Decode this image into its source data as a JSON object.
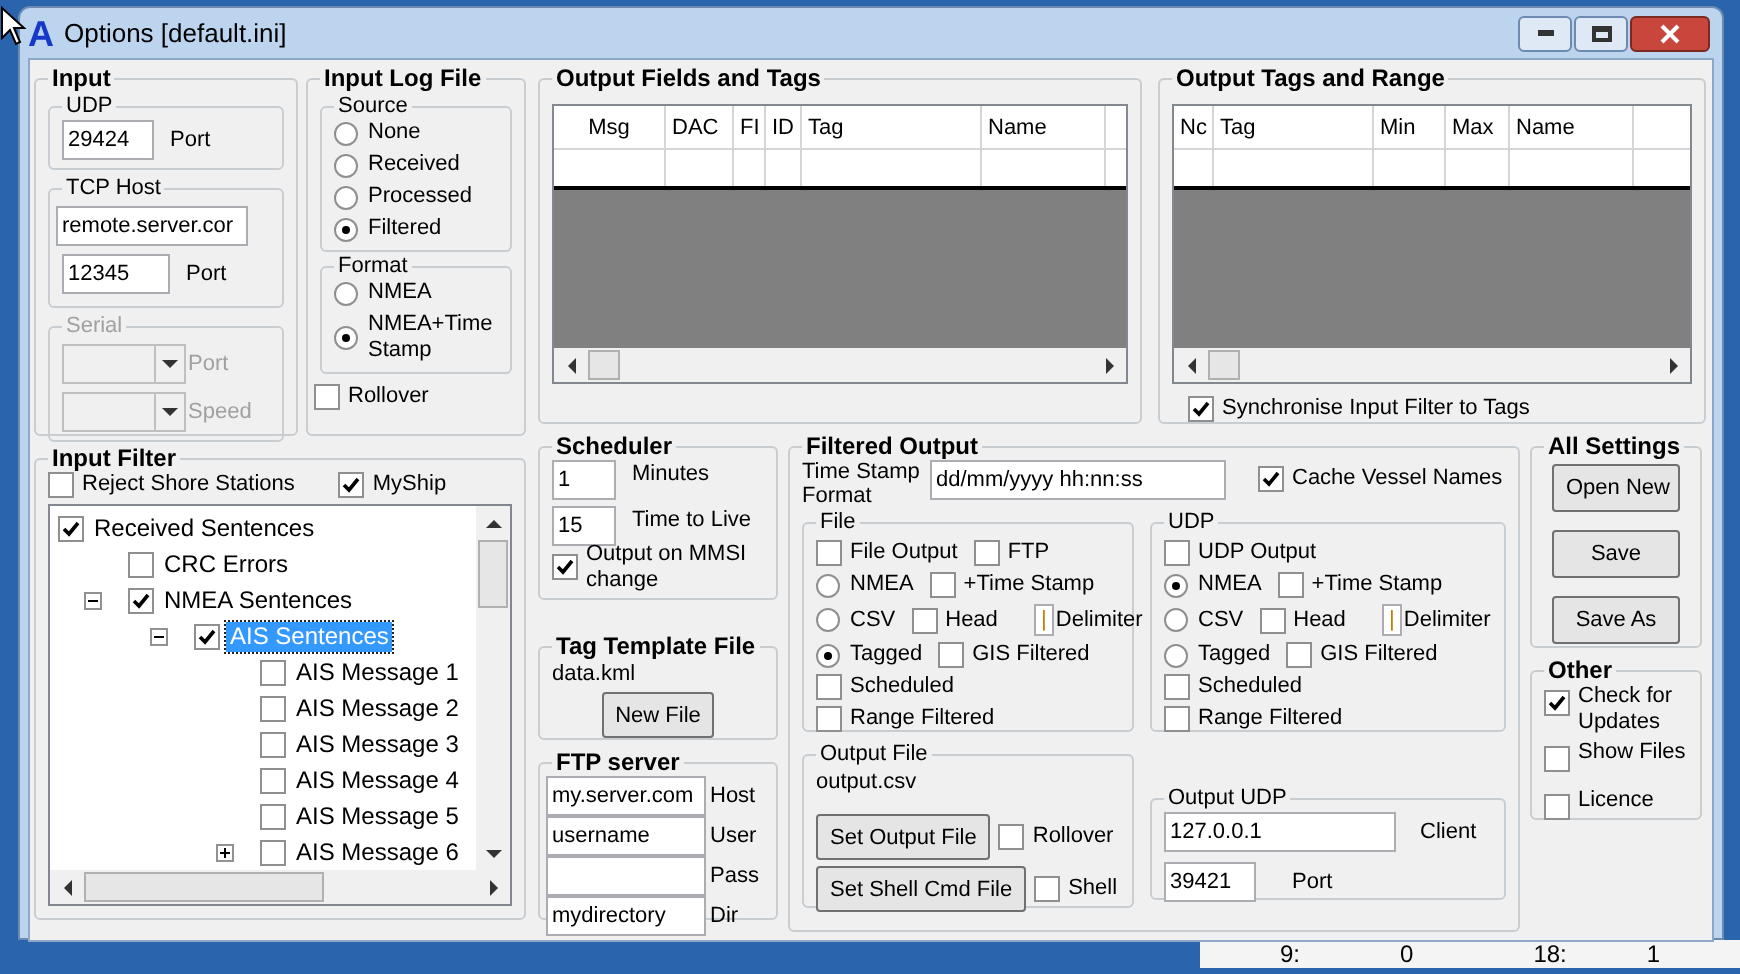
{
  "window": {
    "logo": "A",
    "title": "Options [default.ini]"
  },
  "input": {
    "title": "Input",
    "udp": {
      "title": "UDP",
      "port_value": "29424",
      "port_label": "Port"
    },
    "tcp": {
      "title": "TCP Host",
      "host_value": "remote.server.cor",
      "port_value": "12345",
      "port_label": "Port"
    },
    "serial": {
      "title": "Serial",
      "disabled": true,
      "port_label": "Port",
      "speed_label": "Speed"
    }
  },
  "input_log_file": {
    "title": "Input Log File",
    "source": {
      "title": "Source",
      "options": [
        {
          "label": "None",
          "selected": false
        },
        {
          "label": "Received",
          "selected": false
        },
        {
          "label": "Processed",
          "selected": false
        },
        {
          "label": "Filtered",
          "selected": true
        }
      ]
    },
    "format": {
      "title": "Format",
      "options": [
        {
          "label": "NMEA",
          "selected": false
        },
        {
          "label": "NMEA+Time Stamp",
          "selected": true
        }
      ]
    },
    "rollover": {
      "label": "Rollover",
      "checked": false
    }
  },
  "input_filter": {
    "title": "Input Filter",
    "options": [
      {
        "label": "Reject Shore Stations",
        "checked": false
      },
      {
        "label": "MyShip",
        "checked": true
      }
    ],
    "tree": [
      {
        "label": "Received Sentences",
        "checked": true,
        "selected": false,
        "children": [
          {
            "label": "CRC Errors",
            "checked": false,
            "selected": false
          },
          {
            "label": "NMEA Sentences",
            "checked": true,
            "selected": false,
            "expanded": true,
            "children": [
              {
                "label": "AIS Sentences",
                "checked": true,
                "selected": true,
                "expanded": true,
                "children": [
                  {
                    "label": "AIS Message 1",
                    "checked": false,
                    "selected": false
                  },
                  {
                    "label": "AIS Message 2",
                    "checked": false,
                    "selected": false
                  },
                  {
                    "label": "AIS Message 3",
                    "checked": false,
                    "selected": false
                  },
                  {
                    "label": "AIS Message 4",
                    "checked": false,
                    "selected": false
                  },
                  {
                    "label": "AIS Message 5",
                    "checked": false,
                    "selected": false
                  },
                  {
                    "label": "AIS Message 6",
                    "checked": false,
                    "selected": false,
                    "expanded": false
                  }
                ]
              }
            ]
          }
        ]
      }
    ]
  },
  "output_fields": {
    "title": "Output Fields and Tags",
    "columns": [
      "Msg",
      "DAC",
      "FI",
      "ID",
      "Tag",
      "Name"
    ]
  },
  "output_tags": {
    "title": "Output Tags and Range",
    "columns": [
      "Nc",
      "Tag",
      "Min",
      "Max",
      "Name"
    ],
    "sync": {
      "label": "Synchronise Input Filter to Tags",
      "checked": true
    }
  },
  "scheduler": {
    "title": "Scheduler",
    "rows": [
      {
        "value": "1",
        "label": "Minutes"
      },
      {
        "value": "15",
        "label": "Time to Live"
      }
    ],
    "mmsi": {
      "label": "Output on MMSI change",
      "checked": true
    }
  },
  "tag_template": {
    "title": "Tag Template File",
    "file": "data.kml",
    "button": "New File"
  },
  "ftp": {
    "title": "FTP server",
    "rows": [
      {
        "value": "my.server.com",
        "label": "Host"
      },
      {
        "value": "username",
        "label": "User"
      },
      {
        "value": "",
        "label": "Pass"
      },
      {
        "value": "mydirectory",
        "label": "Dir"
      }
    ]
  },
  "filtered_output": {
    "title": "Filtered Output",
    "timestamp_label": "Time Stamp Format",
    "timestamp_value": "dd/mm/yyyy hh:nn:ss",
    "cache": {
      "label": "Cache Vessel Names",
      "checked": true
    },
    "groups": [
      {
        "title": "File",
        "rows": [
          [
            {
              "kind": "checkbox",
              "label": "File Output",
              "checked": false
            },
            {
              "kind": "checkbox",
              "label": "FTP",
              "checked": false
            }
          ],
          [
            {
              "kind": "radio",
              "label": "NMEA",
              "selected": false
            },
            {
              "kind": "checkbox",
              "label": "+Time Stamp",
              "checked": false
            }
          ],
          [
            {
              "kind": "radio",
              "label": "CSV",
              "selected": false
            },
            {
              "kind": "checkbox",
              "label": "Head",
              "checked": false
            },
            {
              "kind": "delimiter",
              "value": "|",
              "label": "Delimiter"
            }
          ],
          [
            {
              "kind": "radio",
              "label": "Tagged",
              "selected": true
            },
            {
              "kind": "checkbox",
              "label": "GIS Filtered",
              "checked": false
            }
          ],
          [
            {
              "kind": "checkbox",
              "label": "Scheduled",
              "checked": false
            }
          ],
          [
            {
              "kind": "checkbox",
              "label": "Range Filtered",
              "checked": false
            }
          ]
        ]
      },
      {
        "title": "UDP",
        "rows": [
          [
            {
              "kind": "checkbox",
              "label": "UDP Output",
              "checked": false
            }
          ],
          [
            {
              "kind": "radio",
              "label": "NMEA",
              "selected": true
            },
            {
              "kind": "checkbox",
              "label": "+Time Stamp",
              "checked": false
            }
          ],
          [
            {
              "kind": "radio",
              "label": "CSV",
              "selected": false
            },
            {
              "kind": "checkbox",
              "label": "Head",
              "checked": false
            },
            {
              "kind": "delimiter",
              "value": "|",
              "label": "Delimiter"
            }
          ],
          [
            {
              "kind": "radio",
              "label": "Tagged",
              "selected": false
            },
            {
              "kind": "checkbox",
              "label": "GIS Filtered",
              "checked": false
            }
          ],
          [
            {
              "kind": "checkbox",
              "label": "Scheduled",
              "checked": false
            }
          ],
          [
            {
              "kind": "checkbox",
              "label": "Range Filtered",
              "checked": false
            }
          ]
        ]
      }
    ],
    "output_file": {
      "title": "Output File",
      "file": "output.csv",
      "rows": [
        {
          "button": "Set Output File",
          "option": {
            "label": "Rollover",
            "checked": false
          }
        },
        {
          "button": "Set Shell Cmd File",
          "option": {
            "label": "Shell",
            "checked": false
          }
        }
      ]
    },
    "output_udp": {
      "title": "Output UDP",
      "client_value": "127.0.0.1",
      "client_label": "Client",
      "port_value": "39421",
      "port_label": "Port"
    }
  },
  "all_settings": {
    "title": "All Settings",
    "buttons": [
      "Open New",
      "Save",
      "Save As"
    ]
  },
  "other": {
    "title": "Other",
    "options": [
      {
        "label": "Check for Updates",
        "checked": true
      },
      {
        "label": "Show Files",
        "checked": false
      },
      {
        "label": "Licence",
        "checked": false
      }
    ]
  },
  "background": {
    "texts": [
      "9:",
      "0",
      "18:",
      "1"
    ]
  }
}
